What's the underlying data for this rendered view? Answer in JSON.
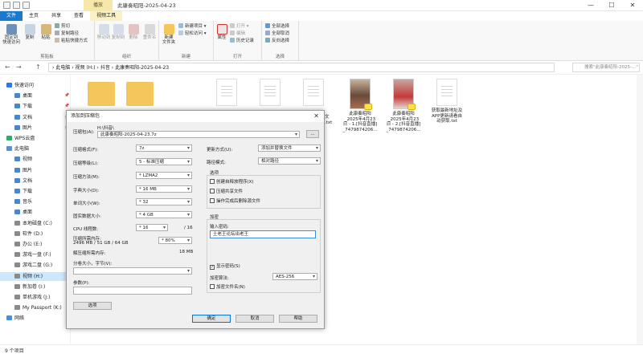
{
  "window": {
    "title": "此康奏昭阳-2025-04-23",
    "context_tab": "播放",
    "controls": [
      "—",
      "☐",
      "✕"
    ]
  },
  "ribbon_tabs": [
    "文件",
    "主页",
    "共享",
    "查看",
    "视频工具"
  ],
  "ribbon": {
    "clipboard": {
      "pin_label": "固定到\n快速访问",
      "copy": "复制",
      "paste": "粘贴",
      "cut": "剪切",
      "copy_path": "复制路径",
      "paste_shortcut": "粘贴快捷方式",
      "group": "剪贴板"
    },
    "organize": {
      "move_to": "移动到",
      "copy_to": "复制到",
      "delete": "删除",
      "rename": "重命名",
      "group": "组织"
    },
    "new": {
      "new_folder": "新建\n文件夹",
      "new_item": "新建项目 ▾",
      "easy_access": "轻松访问 ▾",
      "group": "新建"
    },
    "open": {
      "properties": "属性",
      "open": "打开 ▾",
      "edit": "编辑",
      "history": "历史记录",
      "group": "打开"
    },
    "select": {
      "select_all": "全部选择",
      "select_none": "全部取消",
      "invert": "反向选择",
      "group": "选择"
    }
  },
  "address": {
    "back": "←",
    "forward": "→",
    "up": "↑",
    "path": "› 此电脑 › 视频 (H:) › 抖音 › 此康奏昭阳-2025-04-23",
    "search_placeholder": "搜索\"此康奏昭阳-2025-...\""
  },
  "nav": [
    {
      "label": "快速访问",
      "indent": 0
    },
    {
      "label": "桌面",
      "indent": 1
    },
    {
      "label": "下载",
      "indent": 1
    },
    {
      "label": "文档",
      "indent": 1
    },
    {
      "label": "图片",
      "indent": 1
    },
    {
      "label": "WPS云盘",
      "indent": 0
    },
    {
      "label": "此电脑",
      "indent": 0
    },
    {
      "label": "视频",
      "indent": 1
    },
    {
      "label": "图片",
      "indent": 1
    },
    {
      "label": "文档",
      "indent": 1
    },
    {
      "label": "下载",
      "indent": 1
    },
    {
      "label": "音乐",
      "indent": 1
    },
    {
      "label": "桌面",
      "indent": 1
    },
    {
      "label": "本地磁盘 (C:)",
      "indent": 1
    },
    {
      "label": "软件 (D:)",
      "indent": 1
    },
    {
      "label": "办公 (E:)",
      "indent": 1
    },
    {
      "label": "游戏一盘 (F:)",
      "indent": 1
    },
    {
      "label": "游戏二盘 (G:)",
      "indent": 1
    },
    {
      "label": "视频 (H:)",
      "indent": 1
    },
    {
      "label": "新加卷 (I:)",
      "indent": 1
    },
    {
      "label": "单机游戏 (J:)",
      "indent": 1
    },
    {
      "label": "My Passport (K:)",
      "indent": 1
    },
    {
      "label": "网络",
      "indent": 0
    }
  ],
  "files": [
    {
      "name": "",
      "kind": "folder"
    },
    {
      "name": "",
      "kind": "folder"
    },
    {
      "name": "",
      "kind": "doc"
    },
    {
      "name": "",
      "kind": "doc"
    },
    {
      "name": "",
      "kind": "doc"
    },
    {
      "name": "此康奏昭阳\n_2025年4月23\n日 - 1.[抖音直播]\n_7479874206...",
      "kind": "photo"
    },
    {
      "name": "此康奏昭阳\n_2025年4月23\n日 - 2.[抖音直播]\n_7479874206...",
      "kind": "photo-b"
    },
    {
      "name": "获取最新地址及\nAPP更新请看自\n动获取.txt",
      "kind": "doc"
    }
  ],
  "partial_labels": {
    "txt_tail": "文\n.txt"
  },
  "status": {
    "count": "9 个项目"
  },
  "dialog": {
    "title": "添加到压缩包",
    "close": "✕",
    "archive_label": "压缩包(A):",
    "archive_dir": "H:\\抖音\\",
    "archive_name": "此康奏昭阳-2025-04-23.7z",
    "browse": "...",
    "format_label": "压缩格式(F):",
    "format": "7z",
    "level_label": "压缩等级(L):",
    "level": "5 - 标准压缩",
    "method_label": "压缩方法(M):",
    "method": "* LZMA2",
    "dict_label": "字典大小(D):",
    "dict": "* 16 MB",
    "word_label": "单词大小(W):",
    "word": "* 32",
    "solid_label": "固实数据大小:",
    "solid": "* 4 GB",
    "cpu_label": "CPU 线程数:",
    "cpu": "* 16",
    "cpu_total": "/ 16",
    "mem_label": "压缩所需内存:",
    "mem_detail": "2496 MB / 51 GB / 64 GB",
    "mem_pct": "* 80%",
    "decomp_label": "解压缩所需内存:",
    "decomp_value": "18 MB",
    "split_label": "分卷大小，字节(V):",
    "param_label": "参数(P):",
    "options_btn": "选项",
    "update_label": "更新方式(U):",
    "update": "添加并替换文件",
    "path_label": "路径模式:",
    "path": "相对路径",
    "options_group": "选项",
    "opt_sfx": "创建自释放程序(X)",
    "opt_shared": "压缩共享文件",
    "opt_delete": "操作完成后删除源文件",
    "encrypt_group": "加密",
    "pw_label": "输入密码:",
    "pw_value": "土老王论坛出老王",
    "show_pw": "显示密码(S)",
    "enc_method_label": "加密算法:",
    "enc_method": "AES-256",
    "enc_names": "加密文件名(N)",
    "ok": "确定",
    "cancel": "取消",
    "help": "帮助"
  }
}
